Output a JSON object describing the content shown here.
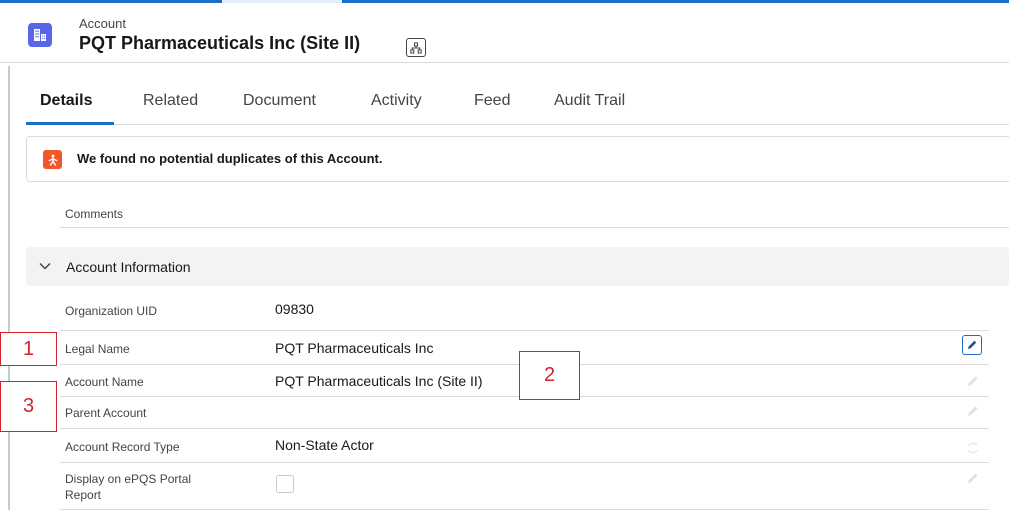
{
  "header": {
    "object_type": "Account",
    "record_name": "PQT Pharmaceuticals Inc (Site II)",
    "icon": "account-icon",
    "hierarchy_icon": "hierarchy-icon"
  },
  "tabs": [
    {
      "label": "Details",
      "active": true
    },
    {
      "label": "Related",
      "active": false
    },
    {
      "label": "Document",
      "active": false
    },
    {
      "label": "Activity",
      "active": false
    },
    {
      "label": "Feed",
      "active": false
    },
    {
      "label": "Audit Trail",
      "active": false
    }
  ],
  "duplicates": {
    "message": "We found no potential duplicates of this Account.",
    "icon": "duplicate-rules-icon",
    "icon_color": "#f2572a"
  },
  "comments": {
    "label": "Comments"
  },
  "section": {
    "title": "Account Information",
    "expanded": true
  },
  "fields": [
    {
      "label": "Organization UID",
      "value": "09830"
    },
    {
      "label": "Legal Name",
      "value": "PQT Pharmaceuticals Inc"
    },
    {
      "label": "Account Name",
      "value": "PQT Pharmaceuticals Inc (Site II)"
    },
    {
      "label": "Parent Account",
      "value": ""
    },
    {
      "label": "Account Record Type",
      "value": "Non-State Actor"
    },
    {
      "label": "Display on ePQS Portal Report",
      "value": "",
      "checked": false
    }
  ],
  "annotations": [
    "1",
    "2",
    "3"
  ],
  "colors": {
    "brand_blue": "#1b6fc9",
    "account_icon": "#5867e8",
    "annotation_red": "#d1232a"
  }
}
